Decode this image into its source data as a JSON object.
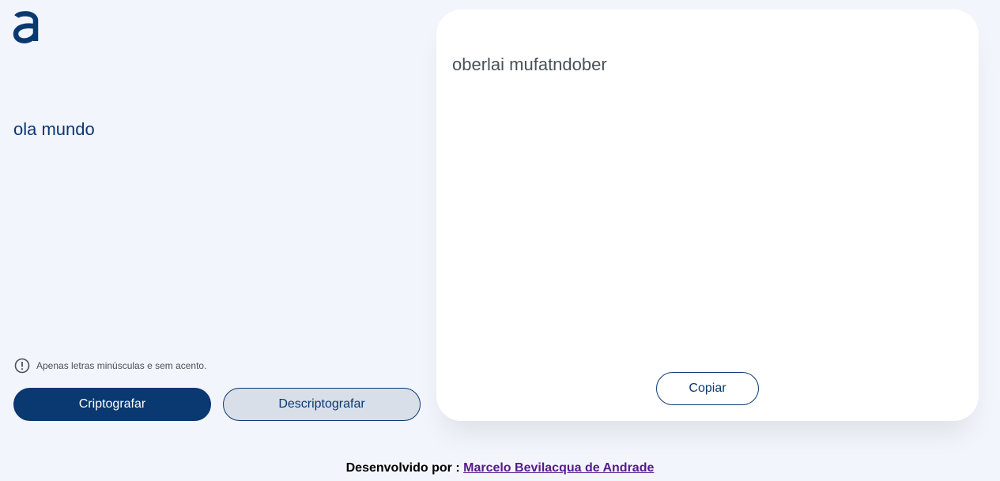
{
  "logo": {
    "icon": "alura-a-logo-icon",
    "color": "#0a3871"
  },
  "input": {
    "value": "ola mundo"
  },
  "hint": {
    "icon": "exclamation-circle-icon",
    "text": "Apenas letras minúsculas e sem acento."
  },
  "buttons": {
    "encrypt": "Criptografar",
    "decrypt": "Descriptografar"
  },
  "output": {
    "text": "oberlai mufatndober",
    "copy": "Copiar"
  },
  "footer": {
    "prefix": "Desenvolvido por :",
    "author": "Marcelo Bevilacqua de Andrade"
  },
  "colors": {
    "accent": "#0a3871",
    "background": "#f3f5fc",
    "link": "#551a8b"
  }
}
